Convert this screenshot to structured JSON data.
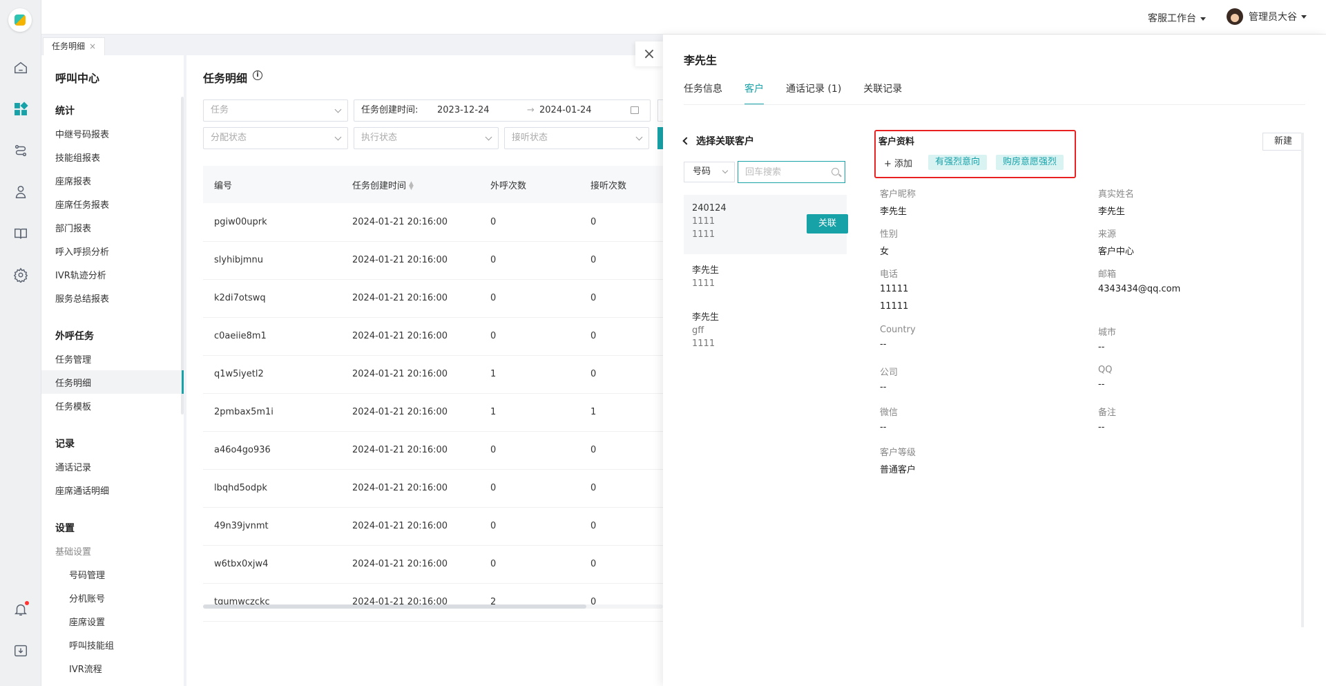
{
  "topbar": {
    "workspace": "客服工作台",
    "user": "管理员大谷"
  },
  "tabstrip": {
    "tab": "任务明细",
    "close": "×"
  },
  "sidebar": {
    "title": "呼叫中心",
    "groups": [
      {
        "label": "统计",
        "items": [
          "中继号码报表",
          "技能组报表",
          "座席报表",
          "座席任务报表",
          "部门报表",
          "呼入呼损分析",
          "IVR轨迹分析",
          "服务总结报表"
        ]
      },
      {
        "label": "外呼任务",
        "items": [
          "任务管理",
          "任务明细",
          "任务模板"
        ]
      },
      {
        "label": "记录",
        "items": [
          "通话记录",
          "座席通话明细"
        ]
      },
      {
        "label": "设置",
        "sub_header": "基础设置",
        "items": [
          "号码管理",
          "分机账号",
          "座席设置",
          "呼叫技能组",
          "IVR流程"
        ]
      }
    ]
  },
  "main": {
    "title": "任务明细",
    "info": "i",
    "filters": {
      "task": "任务",
      "created_label": "任务创建时间:",
      "date_from": "2023-12-24",
      "date_sep": "→",
      "date_to": "2024-01-24",
      "assign": "分配状态",
      "exec": "执行状态",
      "answer": "接听状态"
    },
    "columns": [
      "编号",
      "任务创建时间",
      "外呼次数",
      "接听次数"
    ],
    "rows": [
      [
        "pgiw00uprk",
        "2024-01-21 20:16:00",
        "0",
        "0"
      ],
      [
        "slyhibjmnu",
        "2024-01-21 20:16:00",
        "0",
        "0"
      ],
      [
        "k2di7otswq",
        "2024-01-21 20:16:00",
        "0",
        "0"
      ],
      [
        "c0aeiie8m1",
        "2024-01-21 20:16:00",
        "0",
        "0"
      ],
      [
        "q1w5iyetl2",
        "2024-01-21 20:16:00",
        "1",
        "0"
      ],
      [
        "2pmbax5m1i",
        "2024-01-21 20:16:00",
        "1",
        "1"
      ],
      [
        "a46o4go936",
        "2024-01-21 20:16:00",
        "0",
        "0"
      ],
      [
        "lbqhd5odpk",
        "2024-01-21 20:16:00",
        "0",
        "0"
      ],
      [
        "49n39jvnmt",
        "2024-01-21 20:16:00",
        "0",
        "0"
      ],
      [
        "w6tbx0xjw4",
        "2024-01-21 20:16:00",
        "0",
        "0"
      ],
      [
        "tqumwczckc",
        "2024-01-21 20:16:00",
        "2",
        "0"
      ]
    ]
  },
  "drawer": {
    "title": "李先生",
    "close": "×",
    "tabs": [
      "任务信息",
      "客户",
      "通话记录 (1)",
      "关联记录"
    ],
    "back": "选择关联客户",
    "search_type": "号码",
    "search_placeholder": "回车搜索",
    "candidates": [
      {
        "name": "240124",
        "l1": "1111",
        "l2": "1111",
        "action": "关联"
      },
      {
        "name": "李先生",
        "l1": "1111",
        "l2": ""
      },
      {
        "name": "李先生",
        "l1": "gff",
        "l2": "1111"
      }
    ],
    "profile": {
      "header": "客户资料",
      "add": "+ 添加",
      "tags": [
        "有强烈意向",
        "购房意愿强烈"
      ],
      "new": "新建",
      "fields": [
        {
          "label": "客户昵称",
          "value": "李先生"
        },
        {
          "label": "真实姓名",
          "value": "李先生"
        },
        {
          "label": "性别",
          "value": "女"
        },
        {
          "label": "来源",
          "value": "客户中心"
        },
        {
          "label": "电话",
          "value": "11111",
          "value2": "11111"
        },
        {
          "label": "邮箱",
          "value": "4343434@qq.com"
        },
        {
          "label": "Country",
          "value": "--"
        },
        {
          "label": "城市",
          "value": "--"
        },
        {
          "label": "公司",
          "value": "--"
        },
        {
          "label": "QQ",
          "value": "--"
        },
        {
          "label": "微信",
          "value": "--"
        },
        {
          "label": "备注",
          "value": "--"
        },
        {
          "label": "客户等级",
          "value": "普通客户"
        }
      ]
    }
  },
  "colors": {
    "accent": "#17a2a8",
    "highlight_box": "#e82020"
  }
}
